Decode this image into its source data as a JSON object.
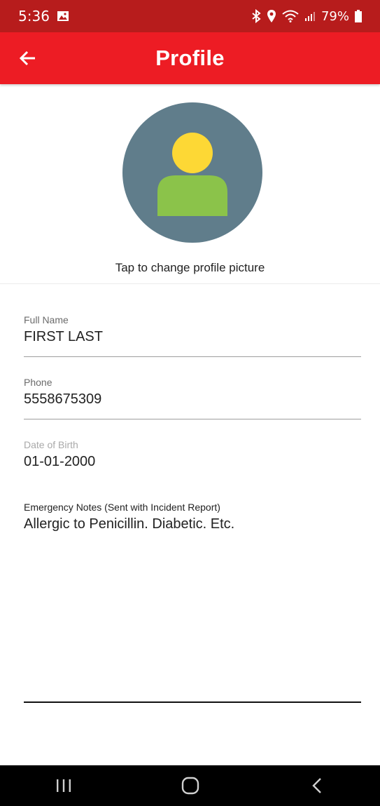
{
  "status_bar": {
    "time": "5:36",
    "battery": "79%"
  },
  "app_bar": {
    "title": "Profile"
  },
  "profile": {
    "caption": "Tap to change profile picture"
  },
  "fields": {
    "full_name": {
      "label": "Full Name",
      "value": "FIRST LAST"
    },
    "phone": {
      "label": "Phone",
      "value": "5558675309"
    },
    "dob": {
      "label": "Date of Birth",
      "value": "01-01-2000"
    },
    "notes": {
      "label": "Emergency Notes (Sent with Incident Report)",
      "value": "Allergic to Penicillin. Diabetic. Etc."
    }
  },
  "colors": {
    "status_bar": "#b71c1c",
    "app_bar": "#ed1c24",
    "avatar_bg": "#607d8b",
    "avatar_head": "#fdd835",
    "avatar_body": "#8bc34a"
  },
  "icons": {
    "gallery": "image-icon",
    "bluetooth": "bluetooth-icon",
    "location": "location-pin-icon",
    "wifi": "wifi-icon",
    "signal": "signal-icon",
    "battery": "battery-icon",
    "back": "arrow-back-icon",
    "recents": "recents-icon",
    "home": "home-icon",
    "nav_back": "nav-back-icon"
  }
}
